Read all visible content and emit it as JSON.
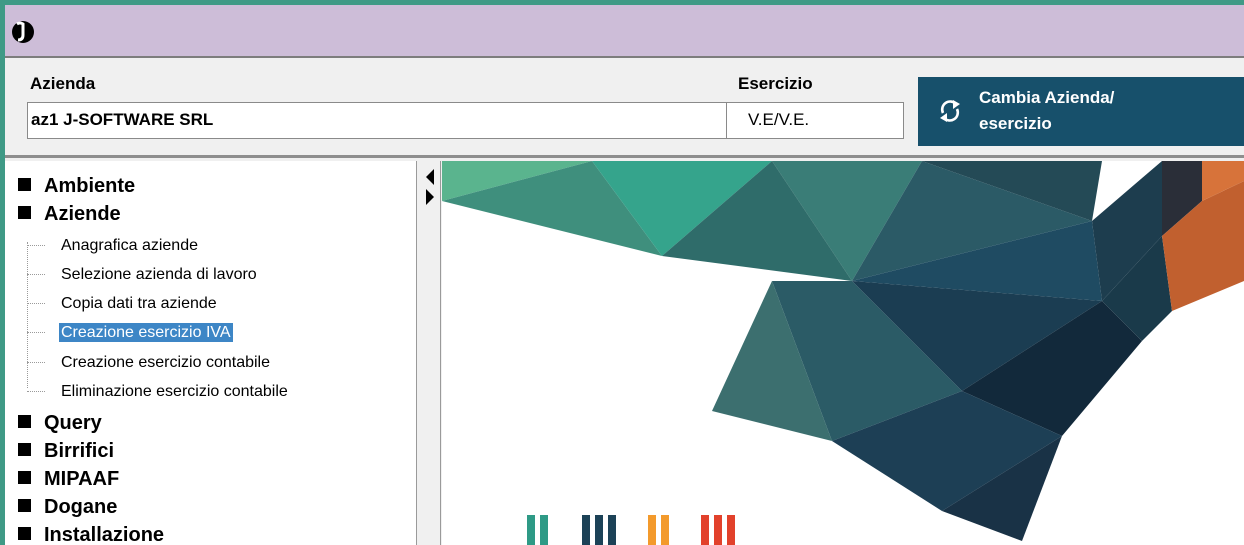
{
  "header": {
    "azienda_label": "Azienda",
    "azienda_value": "az1 J-SOFTWARE SRL",
    "esercizio_label": "Esercizio",
    "esercizio_value": "V.E/V.E.",
    "cambia_button_line1": "Cambia Azienda/",
    "cambia_button_line2": "esercizio"
  },
  "menu": {
    "groups": [
      "Ambiente",
      "Aziende",
      "Query",
      "Birrifici",
      "MIPAAF",
      "Dogane",
      "Installazione"
    ],
    "aziende_items": [
      "Anagrafica aziende",
      "Selezione azienda di lavoro",
      "Copia dati tra aziende",
      "Creazione esercizio IVA",
      "Creazione esercizio contabile",
      "Eliminazione esercizio contabile"
    ],
    "selected_item": "Creazione esercizio IVA"
  },
  "colors": {
    "window_border": "#3f9a86",
    "titlebar": "#cdbdd8",
    "button_bg": "#17506b",
    "selection": "#3d86c6"
  },
  "icons": {
    "app": "j-logo-icon",
    "refresh": "refresh-icon",
    "splitter": "collapse-expand-arrows-icon"
  }
}
